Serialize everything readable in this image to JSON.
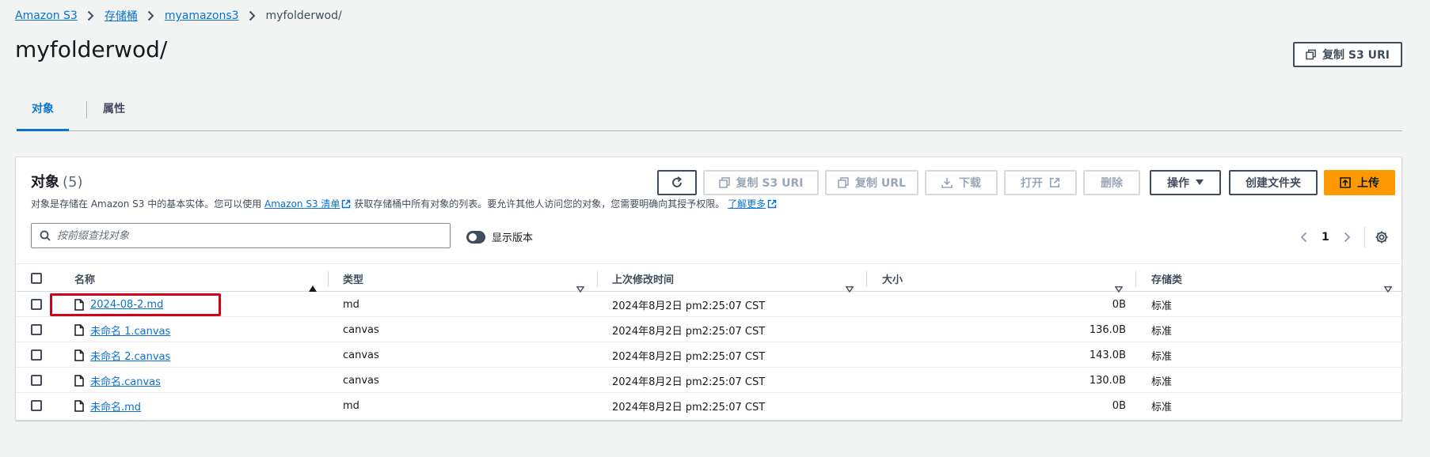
{
  "breadcrumb": [
    {
      "label": "Amazon S3"
    },
    {
      "label": "存储桶"
    },
    {
      "label": "myamazons3"
    },
    {
      "label": "myfolderwod/"
    }
  ],
  "page": {
    "title": "myfolderwod/",
    "copy_s3_uri_label": "复制 S3 URI"
  },
  "tabs": [
    {
      "label": "对象",
      "active": true
    },
    {
      "label": "属性",
      "active": false
    }
  ],
  "objects_panel": {
    "title": "对象",
    "count": "(5)",
    "description_before": "对象是存储在 Amazon S3 中的基本实体。您可以使用",
    "description_link": "Amazon S3 清单",
    "description_middle": "获取存储桶中所有对象的列表。要允许其他人访问您的对象，您需要明确向其授予权限。",
    "learn_more": "了解更多",
    "toolbar": {
      "copy_s3_uri": "复制 S3 URI",
      "copy_url": "复制 URL",
      "download": "下载",
      "open": "打开",
      "delete": "删除",
      "actions": "操作",
      "create_folder": "创建文件夹",
      "upload": "上传"
    },
    "search_placeholder": "按前缀查找对象",
    "show_versions_label": "显示版本",
    "page_number": "1",
    "columns": {
      "name": "名称",
      "type": "类型",
      "last_modified": "上次修改时间",
      "size": "大小",
      "storage_class": "存储类"
    },
    "rows": [
      {
        "name": "2024-08-2.md",
        "type": "md",
        "last_modified": "2024年8月2日 pm2:25:07 CST",
        "size": "0B",
        "storage_class": "标准"
      },
      {
        "name": "未命名 1.canvas",
        "type": "canvas",
        "last_modified": "2024年8月2日 pm2:25:07 CST",
        "size": "136.0B",
        "storage_class": "标准"
      },
      {
        "name": "未命名 2.canvas",
        "type": "canvas",
        "last_modified": "2024年8月2日 pm2:25:07 CST",
        "size": "143.0B",
        "storage_class": "标准"
      },
      {
        "name": "未命名.canvas",
        "type": "canvas",
        "last_modified": "2024年8月2日 pm2:25:07 CST",
        "size": "130.0B",
        "storage_class": "标准"
      },
      {
        "name": "未命名.md",
        "type": "md",
        "last_modified": "2024年8月2日 pm2:25:07 CST",
        "size": "0B",
        "storage_class": "标准"
      }
    ]
  },
  "colors": {
    "link": "#0972d3",
    "primary_button": "#ff9900",
    "highlight_box": "#d0021b"
  }
}
